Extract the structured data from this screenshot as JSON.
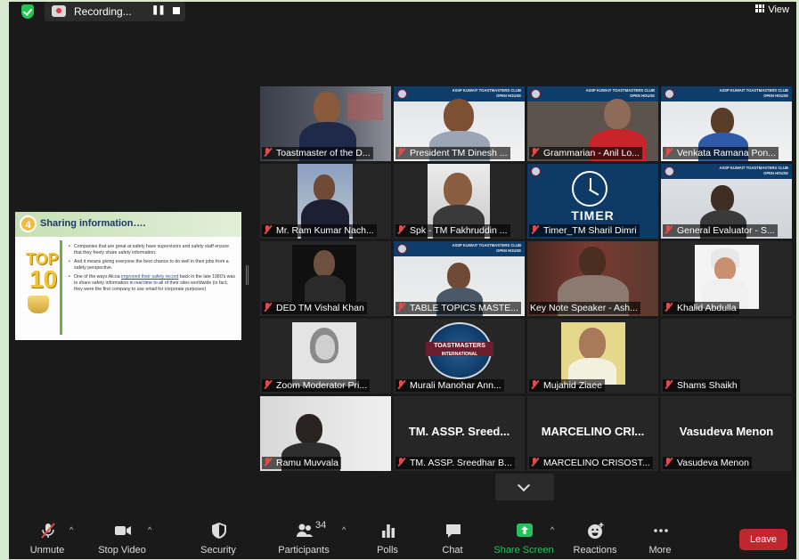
{
  "topbar": {
    "recording_label": "Recording...",
    "pause_icon": "pause-icon",
    "stop_icon": "stop-icon",
    "view_label": "View"
  },
  "share": {
    "slide_number": "4",
    "title": "Sharing information….",
    "logo_text_top": "TOP",
    "logo_text_num": "10",
    "bullets": [
      "Companies that are great at safety have supervisors and safety staff ensure that they freely share safety information.",
      "And it means giving everyone the best chance to do well in their jobs from a safety perspective.",
      "One of the ways Alcoa",
      "improved their safety record",
      "back in the late 1980's was to share safety information in real time to all of their sites worldwide (in fact, they were the first company to use email for corporate purposes)"
    ]
  },
  "banner_text": {
    "line1": "ASSP KUWAIT TOASTMASTERS CLUB",
    "line2": "OPEN HOUSE"
  },
  "participants": [
    {
      "name": "Toastmaster of the D..."
    },
    {
      "name": "President TM Dinesh ..."
    },
    {
      "name": "Grammarian - Anil Lo..."
    },
    {
      "name": "Venkata Ramana Pon..."
    },
    {
      "name": "Mr. Ram Kumar Nach..."
    },
    {
      "name": "Spk - TM Fakhruddin ..."
    },
    {
      "name": "Timer_TM Sharil Dimri",
      "video_text": "TIMER"
    },
    {
      "name": "General Evaluator - S..."
    },
    {
      "name": "DED TM Vishal Khan"
    },
    {
      "name": "TABLE TOPICS MASTE..."
    },
    {
      "name": "Key Note Speaker - Ash..."
    },
    {
      "name": "Khalid Abdulla"
    },
    {
      "name": "Zoom Moderator Pri..."
    },
    {
      "name": "Murali Manohar Ann...",
      "video_text": "TOASTMASTERS",
      "video_subtext": "INTERNATIONAL"
    },
    {
      "name": "Mujahid Ziaee"
    },
    {
      "name": "Shams Shaikh"
    },
    {
      "name": "Ramu Muvvala"
    },
    {
      "name": "TM. ASSP. Sreedhar B...",
      "display_name": "TM. ASSP. Sreed..."
    },
    {
      "name": "MARCELINO CRISOST...",
      "display_name": "MARCELINO CRI..."
    },
    {
      "name": "Vasudeva Menon",
      "display_name": "Vasudeva Menon"
    }
  ],
  "toolbar": {
    "unmute": "Unmute",
    "stop_video": "Stop Video",
    "security": "Security",
    "participants": "Participants",
    "participants_count": "34",
    "polls": "Polls",
    "chat": "Chat",
    "share_screen": "Share Screen",
    "reactions": "Reactions",
    "more": "More",
    "leave": "Leave"
  },
  "colors": {
    "accent_green": "#22c35b",
    "leave_red": "#c0262d",
    "active_speaker": "#cfd448",
    "muted_red": "#e34a4a"
  }
}
